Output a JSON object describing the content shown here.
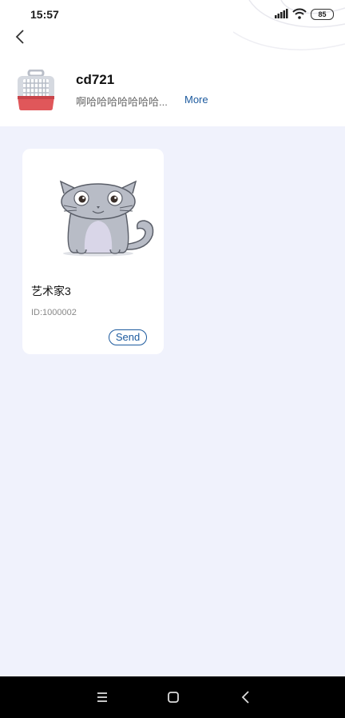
{
  "status_bar": {
    "time": "15:57",
    "battery": "85"
  },
  "shop": {
    "name": "cd721",
    "description": "啊哈哈哈哈哈哈哈...",
    "more_label": "More"
  },
  "items": [
    {
      "name": "艺术家3",
      "id_label": "ID:1000002",
      "send_label": "Send"
    }
  ],
  "colors": {
    "accent": "#1c5a9e",
    "background": "#f0f2fc",
    "card": "#ffffff"
  },
  "icons": {
    "back": "chevron-left-icon",
    "avatar": "pet-carrier-icon",
    "nav_menu": "menu-icon",
    "nav_home": "square-home-icon",
    "nav_back": "back-triangle-icon"
  }
}
